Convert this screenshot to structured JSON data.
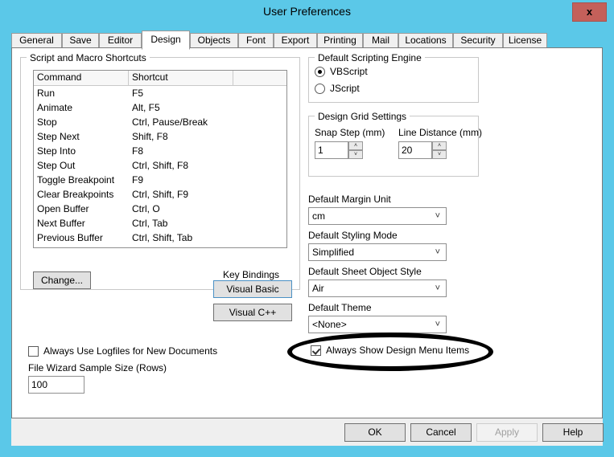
{
  "window": {
    "title": "User Preferences",
    "close_label": "x"
  },
  "tabs": [
    {
      "label": "General",
      "selected": false
    },
    {
      "label": "Save",
      "selected": false
    },
    {
      "label": "Editor",
      "selected": false
    },
    {
      "label": "Design",
      "selected": true
    },
    {
      "label": "Objects",
      "selected": false
    },
    {
      "label": "Font",
      "selected": false
    },
    {
      "label": "Export",
      "selected": false
    },
    {
      "label": "Printing",
      "selected": false
    },
    {
      "label": "Mail",
      "selected": false
    },
    {
      "label": "Locations",
      "selected": false
    },
    {
      "label": "Security",
      "selected": false
    },
    {
      "label": "License",
      "selected": false
    }
  ],
  "shortcuts_group": {
    "legend": "Script and Macro Shortcuts",
    "columns": [
      "Command",
      "Shortcut",
      ""
    ],
    "rows": [
      {
        "command": "Run",
        "shortcut": "F5"
      },
      {
        "command": "Animate",
        "shortcut": "Alt, F5"
      },
      {
        "command": "Stop",
        "shortcut": "Ctrl, Pause/Break"
      },
      {
        "command": "Step Next",
        "shortcut": "Shift, F8"
      },
      {
        "command": "Step Into",
        "shortcut": "F8"
      },
      {
        "command": "Step Out",
        "shortcut": "Ctrl, Shift, F8"
      },
      {
        "command": "Toggle Breakpoint",
        "shortcut": "F9"
      },
      {
        "command": "Clear Breakpoints",
        "shortcut": "Ctrl, Shift, F9"
      },
      {
        "command": "Open Buffer",
        "shortcut": "Ctrl, O"
      },
      {
        "command": "Next Buffer",
        "shortcut": "Ctrl, Tab"
      },
      {
        "command": "Previous Buffer",
        "shortcut": "Ctrl, Shift, Tab"
      }
    ],
    "change_button": "Change...",
    "key_bindings_label": "Key Bindings",
    "visual_basic_button": "Visual Basic",
    "visual_cpp_button": "Visual C++"
  },
  "left_options": {
    "logfiles_checkbox": {
      "label": "Always Use Logfiles for New Documents",
      "checked": false
    },
    "sample_size_label": "File Wizard Sample Size (Rows)",
    "sample_size_value": "100"
  },
  "scripting_engine": {
    "legend": "Default Scripting Engine",
    "options": [
      {
        "label": "VBScript",
        "selected": true
      },
      {
        "label": "JScript",
        "selected": false
      }
    ]
  },
  "grid_settings": {
    "legend": "Design Grid Settings",
    "snap_step_label": "Snap Step (mm)",
    "snap_step_value": "1",
    "line_distance_label": "Line Distance (mm)",
    "line_distance_value": "20",
    "spin_up": "˄",
    "spin_down": "˅"
  },
  "dropdowns": [
    {
      "label": "Default Margin Unit",
      "value": "cm"
    },
    {
      "label": "Default Styling Mode",
      "value": "Simplified"
    },
    {
      "label": "Default Sheet Object Style",
      "value": "Air"
    },
    {
      "label": "Default Theme",
      "value": "<None>"
    }
  ],
  "design_menu_checkbox": {
    "label": "Always Show Design Menu Items",
    "checked": true
  },
  "footer": {
    "ok": "OK",
    "cancel": "Cancel",
    "apply": "Apply",
    "help": "Help"
  },
  "colors": {
    "titlebar": "#5bc8e8",
    "close_button": "#c4605a",
    "panel": "#ffffff",
    "footer": "#efefef",
    "focus_border": "#4a90c4",
    "annotation": "#000000"
  },
  "icons": {
    "combo_arrow": "˅"
  }
}
